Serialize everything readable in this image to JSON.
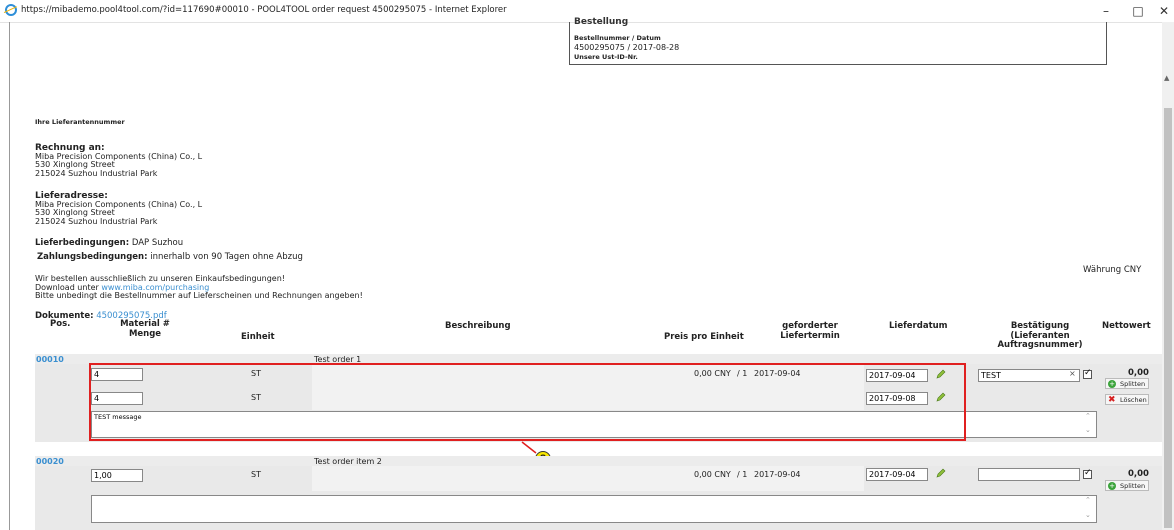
{
  "window": {
    "title": "https://mibademo.pool4tool.com/?id=117690#00010 - POOL4TOOL order request 4500295075 - Internet Explorer",
    "minimize": "–",
    "maximize": "□",
    "close": "✕"
  },
  "order_box": {
    "heading": "Bestellung",
    "label": "Bestellnummer / Datum",
    "value": "4500295075 / 2017-08-28",
    "ust_label": "Unsere Ust-ID-Nr."
  },
  "supplier_no_label": "Ihre Lieferantennummer",
  "billing": {
    "title": "Rechnung an:",
    "lines": [
      "Miba Precision Components (China) Co., L",
      "530 Xinglong Street",
      "215024 Suzhou Industrial Park"
    ]
  },
  "delivery": {
    "title": "Lieferadresse:",
    "lines": [
      "Miba Precision Components (China) Co., L",
      "530 Xinglong Street",
      "215024 Suzhou Industrial Park"
    ]
  },
  "terms": {
    "delivery_label": "Lieferbedingungen:",
    "delivery_value": "DAP Suzhou",
    "payment_label": "Zahlungsbedingungen:",
    "payment_value": "innerhalb von 90 Tagen ohne Abzug"
  },
  "notes": {
    "line1": "Wir bestellen ausschließlich zu unseren Einkaufsbedingungen!",
    "download_prefix": "Download unter",
    "download_link": "www.miba.com/purchasing",
    "line3": "Bitte unbedingt die Bestellnummer auf Lieferscheinen und Rechnungen angeben!"
  },
  "currency": "Währung CNY",
  "documents": {
    "label": "Dokumente:",
    "file": "4500295075.pdf"
  },
  "columns": {
    "pos": "Pos.",
    "material": "Material #",
    "menge": "Menge",
    "einheit": "Einheit",
    "beschreibung": "Beschreibung",
    "preis": "Preis pro Einheit",
    "gef1": "geforderter",
    "gef2": "Liefertermin",
    "lieferdatum": "Lieferdatum",
    "best1": "Bestätigung",
    "best2": "(Lieferanten",
    "best3": "Auftragsnummer)",
    "netto": "Nettowert"
  },
  "items": [
    {
      "pos": "00010",
      "description": "Test order 1",
      "qty1": "4",
      "unit1": "ST",
      "price": "0,00 CNY",
      "per": "/ 1",
      "req_date": "2017-09-04",
      "date1": "2017-09-04",
      "confirmation": "TEST",
      "net": "0,00",
      "split_label": "Splitten",
      "qty2": "4",
      "unit2": "ST",
      "date2": "2017-09-08",
      "delete_label": "Löschen",
      "message": "TEST message"
    },
    {
      "pos": "00020",
      "description": "Test order item 2",
      "qty1": "1,00",
      "unit1": "ST",
      "price": "0,00 CNY",
      "per": "/ 1",
      "req_date": "2017-09-04",
      "date1": "2017-09-04",
      "confirmation": "",
      "net": "0,00",
      "split_label": "Splitten",
      "message": ""
    }
  ],
  "annotation_number": "8",
  "colors": {
    "link": "#3a8fd0",
    "annotation": "#e02020",
    "marker": "#f6e600"
  }
}
